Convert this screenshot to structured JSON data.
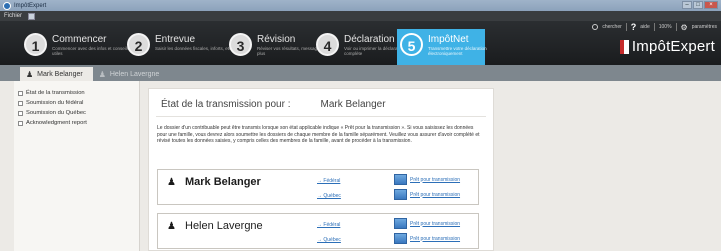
{
  "window": {
    "title": "ImpôtExpert",
    "controls": [
      "–",
      "□",
      "×"
    ]
  },
  "menu": {
    "file": "Fichier"
  },
  "steps": [
    {
      "num": "1",
      "title": "Commencer",
      "sub": "Commencer avec des infos et conseils utiles"
    },
    {
      "num": "2",
      "title": "Entrevue",
      "sub": "Saisir les données fiscales, inforts, etc."
    },
    {
      "num": "3",
      "title": "Révision",
      "sub": "Réviser vos résultats, messages et plus"
    },
    {
      "num": "4",
      "title": "Déclaration",
      "sub": "Voir ou imprimer la déclaration complète"
    },
    {
      "num": "5",
      "title": "ImpôtNet",
      "sub": "Transmettre votre déclaration électroniquement"
    }
  ],
  "toolbar": {
    "search": "chercher",
    "help": "?",
    "help_label": "aide",
    "zoom": "100%",
    "settings": "paramètres"
  },
  "brand": {
    "name": "ImpôtExpert"
  },
  "person_tabs": [
    {
      "label": "Mark Belanger",
      "active": true
    },
    {
      "label": "Helen Lavergne",
      "active": false
    }
  ],
  "sidebar": {
    "items": [
      {
        "label": "État de la transmission"
      },
      {
        "label": "Soumission du fédéral"
      },
      {
        "label": "Soumission du Québec"
      },
      {
        "label": "Acknowledgment report"
      }
    ]
  },
  "main": {
    "heading": "État de la transmission pour :",
    "person": "Mark Belanger",
    "intro": "Le dossier d'un contribuable peut être transmis lorsque son état applicable indique « Prêt pour la transmission ». Si vous saisissez les données pour une famille, vous devrez alors soumettre les dossiers de chaque membre de la famille séparément. Veuillez vous assurer d'avoir complété et révisé toutes les données saisies, y compris celles des membres de la famille, avant de procéder à la transmission.",
    "cards": [
      {
        "name": "Mark Belanger",
        "federal": "→ Fédéral",
        "quebec": "→ Québec",
        "status_fed": "Prêt pour transmission",
        "status_qc": "Prêt pour transmission"
      },
      {
        "name": "Helen Lavergne",
        "federal": "→ Fédéral",
        "quebec": "→ Québec",
        "status_fed": "Prêt pour transmission",
        "status_qc": "Prêt pour transmission"
      }
    ]
  },
  "colors": {
    "accent": "#3fb2e6",
    "dark_bar": "#1f2224",
    "link": "#2c6fb8"
  }
}
